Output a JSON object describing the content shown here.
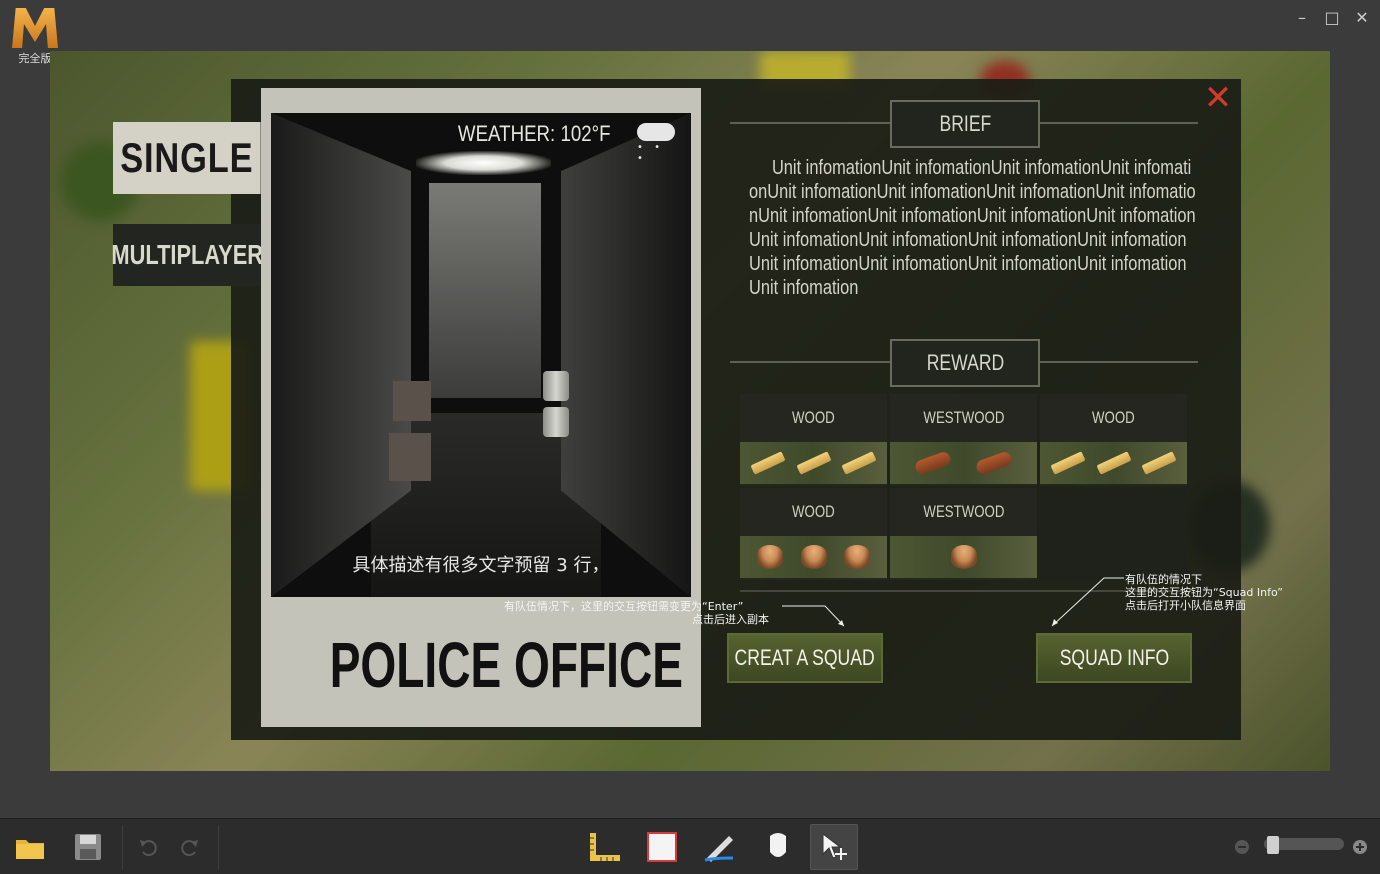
{
  "app": {
    "logo_caption": "完全版"
  },
  "window_controls": {
    "minimize": "–",
    "maximize": "□",
    "close": "✕"
  },
  "tabs": {
    "single": "SINGLE",
    "multiplayer": "MULTIPLAYER"
  },
  "mission": {
    "weather_label": "WEATHER:",
    "weather_temp": "102°F",
    "weather_icon": "rain-cloud-icon",
    "description": "具体描述有很多文字预留 3 行，",
    "name": "POLICE OFFICE"
  },
  "brief": {
    "header": "BRIEF",
    "text": "Unit infomationUnit infomationUnit infomationUnit infomationUnit infomationUnit infomationUnit infomationUnit infomationUnit infomationUnit infomationUnit infomationUnit infomationUnit infomationUnit infomationUnit infomationUnit infomationUnit infomationUnit infomationUnit infomationUnit infomationUnit infomation"
  },
  "reward": {
    "header": "REWARD",
    "items": [
      {
        "label": "WOOD",
        "icon": "plank",
        "count": 3
      },
      {
        "label": "WESTWOOD",
        "icon": "log",
        "count": 2
      },
      {
        "label": "WOOD",
        "icon": "plank",
        "count": 3
      },
      {
        "label": "WOOD",
        "icon": "stump",
        "count": 3
      },
      {
        "label": "WESTWOOD",
        "icon": "stump",
        "count": 1
      }
    ]
  },
  "buttons": {
    "creat_squad": "CREAT A SQUAD",
    "squad_info": "SQUAD INFO",
    "close": "✕"
  },
  "annotations": {
    "left_line1": "有队伍情况下，这里的交互按钮需变更为“Enter”",
    "left_line2": "点击后进入副本",
    "right_line1": "有队伍的情况下",
    "right_line2": "这里的交互按钮为“Squad Info”",
    "right_line3": "点击后打开小队信息界面"
  },
  "toolbar": {
    "icons": [
      "folder-icon",
      "save-icon",
      "undo-icon",
      "redo-icon",
      "ruler-icon",
      "rectangle-icon",
      "pen-icon",
      "marker-icon",
      "move-icon",
      "zoom-out-icon",
      "zoom-in-icon"
    ],
    "zoom_level": 0.05
  },
  "colors": {
    "accent_close": "#d23a2e",
    "button_green": "#566330",
    "card_bg": "#c4c3b9"
  }
}
